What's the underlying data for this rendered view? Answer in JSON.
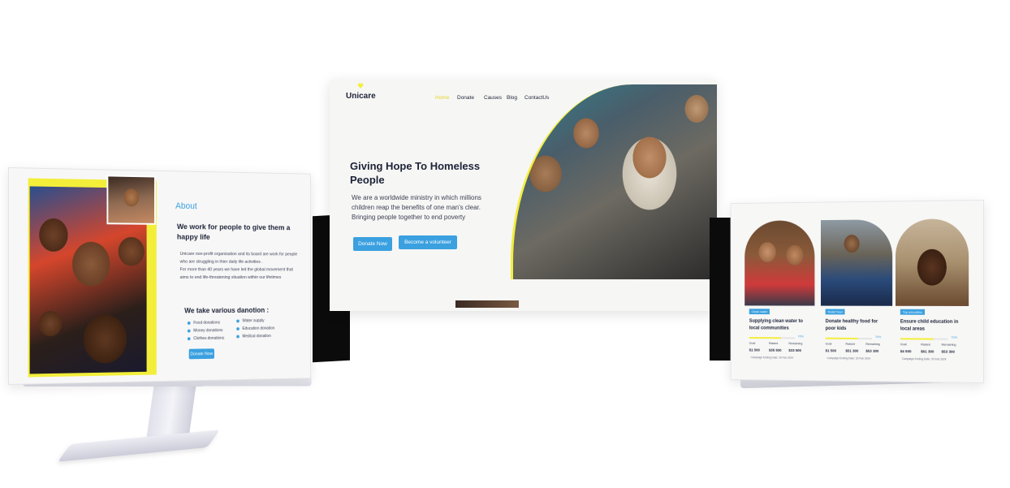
{
  "left": {
    "about_label": "About",
    "heading": "We work for people to give them a happy life",
    "para_1": "Unicare non-profit organisation and its board are work for people who are struggling in thier daily life activities .",
    "para_2": "For more than 40 years we have led the global movement that aims to end life-threatening situation within our lifetimes",
    "donations_title": "We take various danotion :",
    "donations_col1": [
      "Food donations",
      "Money donations",
      "Clothes donations"
    ],
    "donations_col2": [
      "Water supply",
      "Education donation",
      "Medical donation"
    ],
    "donate_button": "Donate Now"
  },
  "center": {
    "logo": "Unicare",
    "nav": [
      "Home",
      "Donate",
      "Causes",
      "Blog",
      "ContactUs"
    ],
    "hero_title": "Giving Hope To Homeless People",
    "hero_sub": "We are a worldwide ministry in which millions children reap the benefits of one man's clear. Bringing people together to end poverty",
    "btn_donate": "Donate Now",
    "btn_volunteer": "Become a volunteer"
  },
  "right": {
    "cards": [
      {
        "tag": "Clean water",
        "title": "Supplying clean water to local communities",
        "progress": 0.7,
        "pct": "70%",
        "goal_label": "Goal",
        "raised_label": "Raised",
        "remaining_label": "Remaining",
        "goal": "$1 500",
        "raised": "$35 500",
        "remaining": "$33 500",
        "date": "Campaign Ending Date: 20 Feb 2024"
      },
      {
        "tag": "Relief food",
        "title": "Donate healthy food for poor kids",
        "progress": 0.7,
        "pct": "70%",
        "goal_label": "Goal",
        "raised_label": "Raised",
        "remaining_label": "Remaining",
        "goal": "$1 500",
        "raised": "$51 300",
        "remaining": "$53 300",
        "date": "Campaign Ending Date: 20 Feb 2024"
      },
      {
        "tag": "Top education",
        "title": "Ensure child education in local areas",
        "progress": 0.7,
        "pct": "70%",
        "goal_label": "Goal",
        "raised_label": "Raised",
        "remaining_label": "Remaining",
        "goal": "$4 500",
        "raised": "$61 300",
        "remaining": "$53 300",
        "date": "Campaign Ending Date: 20 Feb 2024"
      }
    ]
  },
  "colors": {
    "accent_blue": "#3aa0e0",
    "accent_yellow": "#f3ee3a",
    "text_dark": "#1d2338"
  }
}
